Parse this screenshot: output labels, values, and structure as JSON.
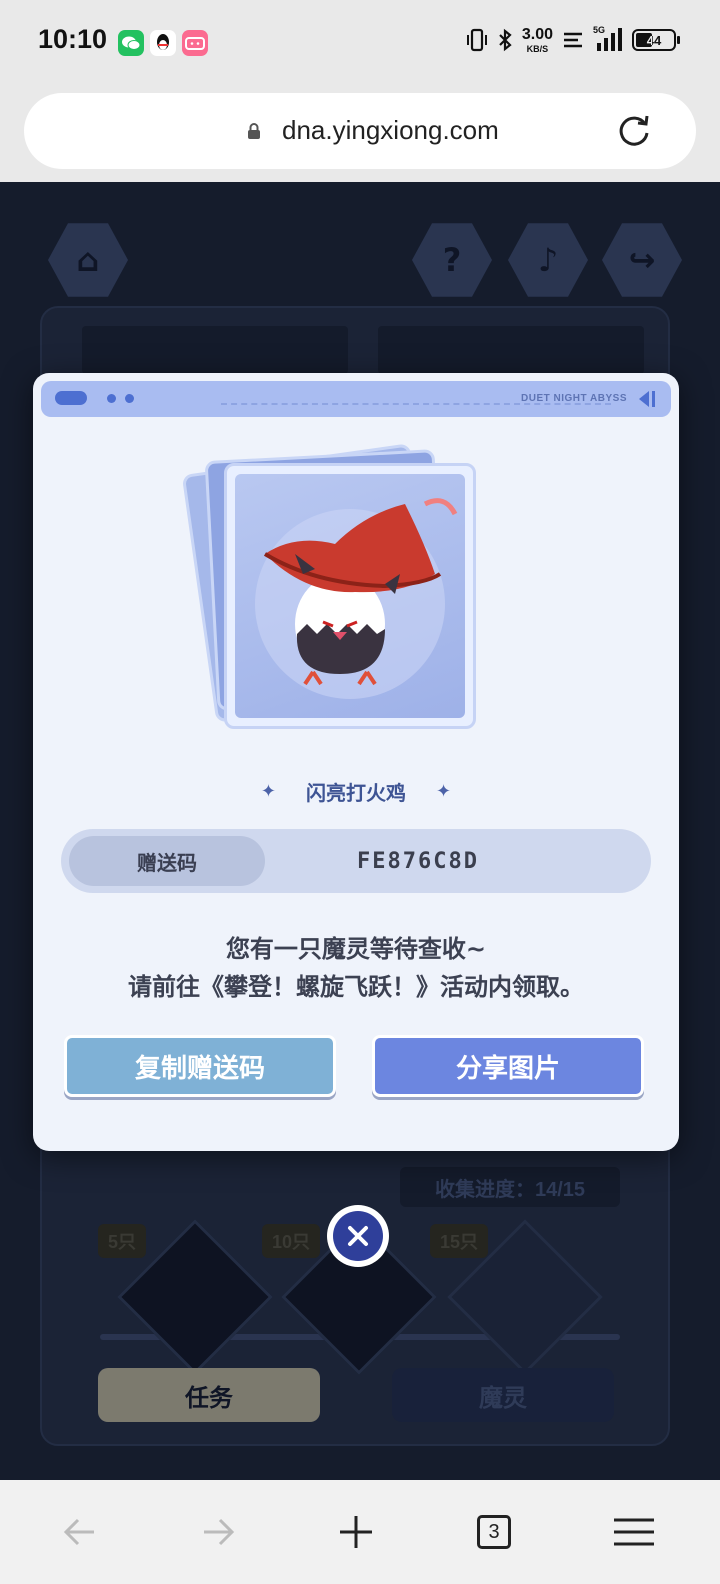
{
  "status_bar": {
    "time": "10:10",
    "net_speed_value": "3.00",
    "net_speed_unit": "KB/S",
    "network": "5G",
    "battery": "44",
    "icons": [
      "wechat-icon",
      "qq-icon",
      "bilibili-icon",
      "vibrate-icon",
      "bluetooth-icon",
      "signal-icon",
      "battery-icon"
    ]
  },
  "browser": {
    "url": "dna.yingxiong.com",
    "tab_count": "3"
  },
  "modal": {
    "brand_text": "DUET NIGHT ABYSS",
    "pet_name": "闪亮打火鸡",
    "code_label": "赠送码",
    "code_value": "FE876C8D",
    "message_line1": "您有一只魔灵等待查收~",
    "message_line2": "请前往《攀登！螺旋飞跃！》活动内领取。",
    "copy_button": "复制赠送码",
    "share_button": "分享图片"
  },
  "background_page": {
    "collect_progress": "收集进度：14/15",
    "milestones": [
      "5只",
      "10只",
      "15只"
    ],
    "task_button": "任务",
    "spirit_button": "魔灵"
  },
  "colors": {
    "modal_bg": "#eff3fb",
    "accent_blue": "#6c86e0",
    "copy_blue": "#7fb1d6",
    "close_navy": "#2f3f9a"
  }
}
